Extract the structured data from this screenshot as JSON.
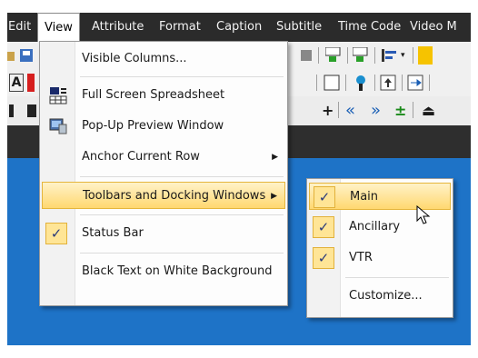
{
  "menubar": {
    "items": [
      "Edit",
      "View",
      "Attribute",
      "Format",
      "Caption",
      "Subtitle",
      "Time Code",
      "Video M"
    ]
  },
  "toolbar3": {
    "plus": "+",
    "rewind": "«",
    "forward": "»",
    "plusminus": "±",
    "eject": "⏏"
  },
  "view_menu": {
    "items": [
      {
        "label": "Visible Columns..."
      },
      {
        "label": "Full Screen Spreadsheet",
        "icon": "spreadsheet-icon"
      },
      {
        "label": "Pop-Up Preview Window",
        "icon": "preview-window-icon"
      },
      {
        "label": "Anchor Current Row",
        "submenu_arrow": "▶"
      },
      {
        "label": "Toolbars and Docking Windows",
        "submenu_arrow": "▶",
        "highlighted": true
      },
      {
        "label": "Status Bar",
        "checked": true,
        "check": "✓"
      },
      {
        "label": "Black Text on White Background"
      }
    ]
  },
  "toolbars_submenu": {
    "items": [
      {
        "label": "Main",
        "checked": true,
        "check": "✓",
        "highlighted": true
      },
      {
        "label": "Ancillary",
        "checked": true,
        "check": "✓"
      },
      {
        "label": "VTR",
        "checked": true,
        "check": "✓"
      },
      {
        "label": "Customize..."
      }
    ]
  },
  "colors": {
    "menubar_bg": "#2b2b2b",
    "workspace_bg": "#1e73c7",
    "highlight": "#ffd870",
    "check_bg": "#ffe596"
  }
}
